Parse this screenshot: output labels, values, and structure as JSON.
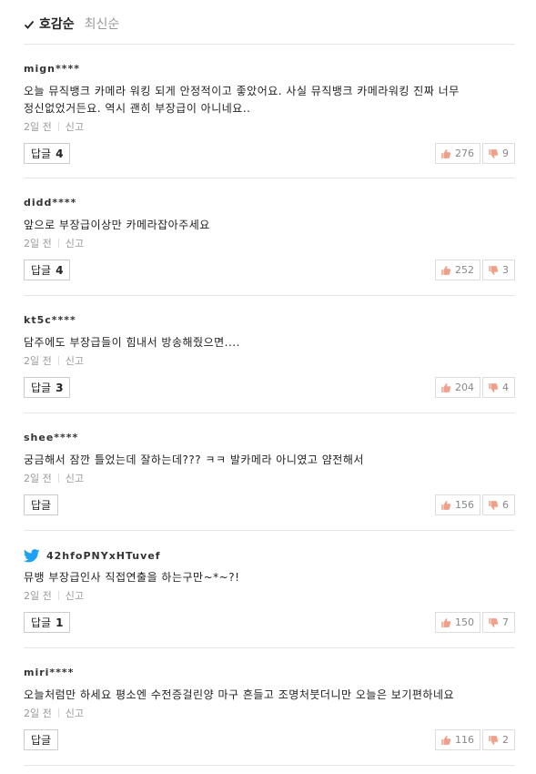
{
  "sort": {
    "active_label": "호감순",
    "inactive_label": "최신순"
  },
  "comments": [
    {
      "author": "mign****",
      "text_lines": [
        "오늘 뮤직뱅크 카메라 워킹 되게 안정적이고 좋았어요. 사실 뮤직뱅크 카메라워킹 진짜 너무",
        "정신없었거든요. 역시 괜히 부장급이 아니네요.."
      ],
      "time": "2일 전",
      "report": "신고",
      "reply_label": "답글",
      "reply_count": "4",
      "likes": "276",
      "dislikes": "9"
    },
    {
      "author": "didd****",
      "text_lines": [
        "앞으로 부장급이상만 카메라잡아주세요"
      ],
      "time": "2일 전",
      "report": "신고",
      "reply_label": "답글",
      "reply_count": "4",
      "likes": "252",
      "dislikes": "3"
    },
    {
      "author": "kt5c****",
      "text_lines": [
        "담주에도 부장급들이 힘내서 방송해줬으면...."
      ],
      "time": "2일 전",
      "report": "신고",
      "reply_label": "답글",
      "reply_count": "3",
      "likes": "204",
      "dislikes": "4"
    },
    {
      "author": "shee****",
      "text_lines": [
        "궁금해서 잠깐 틀었는데 잘하는데??? ㅋㅋ 발카메라 아니였고 얌전해서"
      ],
      "time": "2일 전",
      "report": "신고",
      "reply_label": "답글",
      "reply_count": "",
      "likes": "156",
      "dislikes": "6"
    },
    {
      "author": "42hfoPNYxHTuvef",
      "twitter": true,
      "text_lines": [
        "뮤뱅 부장급인사 직접연출을 하는구만~*~?!"
      ],
      "time": "2일 전",
      "report": "신고",
      "reply_label": "답글",
      "reply_count": "1",
      "likes": "150",
      "dislikes": "7"
    },
    {
      "author": "miri****",
      "text_lines": [
        "오늘처럼만 하세요 평소엔 수전증걸린양 마구 흔들고 조명처붓더니만 오늘은 보기편하네요"
      ],
      "time": "2일 전",
      "report": "신고",
      "reply_label": "답글",
      "reply_count": "",
      "likes": "116",
      "dislikes": "2"
    }
  ],
  "colors": {
    "twitter": "#1da1f2",
    "thumb_up": "#f0a08a",
    "thumb_down": "#f0a08a"
  }
}
